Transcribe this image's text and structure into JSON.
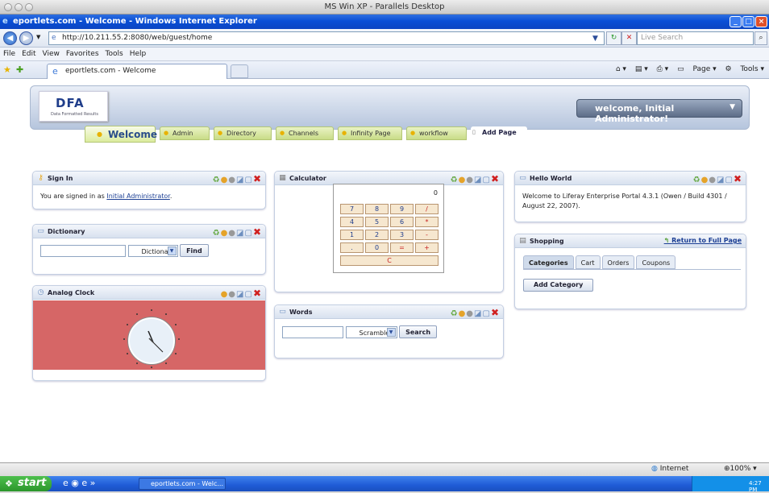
{
  "mac_window": {
    "title": "MS Win XP - Parallels Desktop"
  },
  "ie": {
    "title": "eportlets.com - Welcome - Windows Internet Explorer",
    "address": "http://10.211.55.2:8080/web/guest/home",
    "search_placeholder": "Live Search",
    "menu": [
      "File",
      "Edit",
      "View",
      "Favorites",
      "Tools",
      "Help"
    ],
    "tab_title": "eportlets.com - Welcome",
    "tab_tools": [
      "Page",
      "Tools"
    ],
    "status": {
      "zone": "Internet",
      "zoom": "100%"
    }
  },
  "header": {
    "logo_text": "DFA",
    "logo_sub": "Data Formatted Results",
    "welcome_button": "welcome, Initial Administrator!"
  },
  "nav": {
    "tabs": [
      "Welcome",
      "Admin",
      "Directory",
      "Channels",
      "Infinity Page",
      "workflow"
    ],
    "add_page": "Add Page",
    "selected": "Welcome"
  },
  "portlets": {
    "sign_in": {
      "title": "Sign In",
      "text_prefix": "You are signed in as ",
      "user_link": "Initial Administrator",
      "text_suffix": "."
    },
    "dictionary": {
      "title": "Dictionary",
      "select_value": "Dictionary",
      "button": "Find"
    },
    "analog_clock": {
      "title": "Analog Clock"
    },
    "calculator": {
      "title": "Calculator",
      "display": "0",
      "keys": [
        [
          "7",
          "8",
          "9",
          "/"
        ],
        [
          "4",
          "5",
          "6",
          "*"
        ],
        [
          "1",
          "2",
          "3",
          "-"
        ],
        [
          ".",
          "0",
          "=",
          "+"
        ]
      ],
      "clear": "C"
    },
    "words": {
      "title": "Words",
      "select_value": "Scramble",
      "button": "Search"
    },
    "hello_world": {
      "title": "Hello World",
      "text": "Welcome to Liferay Enterprise Portal 4.3.1 (Owen / Build 4301 / August 22, 2007)."
    },
    "shopping": {
      "title": "Shopping",
      "return_link": "Return to Full Page",
      "tabs": [
        "Categories",
        "Cart",
        "Orders",
        "Coupons"
      ],
      "add_button": "Add Category"
    }
  },
  "taskbar": {
    "start": "start",
    "task_item": "eportlets.com - Welc...",
    "clock": "4:27 PM"
  }
}
